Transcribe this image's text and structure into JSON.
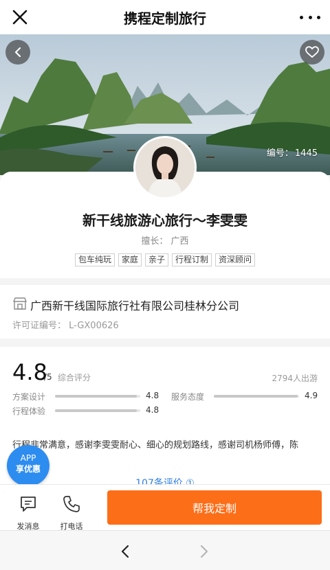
{
  "header": {
    "title": "携程定制旅行",
    "close_icon": "close-icon",
    "more_icon": "more-dots-icon"
  },
  "hero": {
    "id_label": "编号：",
    "id_value": "1445",
    "back_icon": "chevron-left-icon",
    "fav_icon": "heart-icon"
  },
  "profile": {
    "name": "新干线旅游心旅行～李雯雯",
    "specialty": "擅长：  广西",
    "tags": [
      "包车纯玩",
      "家庭",
      "亲子",
      "行程订制",
      "资深顾问"
    ]
  },
  "agency": {
    "icon": "shop-icon",
    "name": "广西新干线国际旅行社有限公司桂林分公司",
    "license": "许可证编号：  L-GX00626"
  },
  "rating": {
    "score": "4.8",
    "score_max": "/5",
    "score_label": "综合评分",
    "travelers": "2794人出游",
    "metrics": [
      {
        "label": "方案设计",
        "value": "4.8",
        "fraction": 0.96
      },
      {
        "label": "服务态度",
        "value": "4.9",
        "fraction": 0.98
      },
      {
        "label": "行程体验",
        "value": "4.8",
        "fraction": 0.96
      }
    ],
    "review": "行程非常满意，感谢李雯雯耐心、细心的规划路线，感谢司机杨师傅，陈",
    "more_reviews": "107条评价 ①"
  },
  "app_badge": {
    "line1": "APP",
    "line2": "享优惠"
  },
  "actions": {
    "message_label": "发消息",
    "call_label": "打电话",
    "cta_label": "帮我定制",
    "cta_color": "#fd6e19"
  },
  "browser": {
    "back_icon": "chevron-left-icon",
    "forward_icon": "chevron-right-icon"
  }
}
